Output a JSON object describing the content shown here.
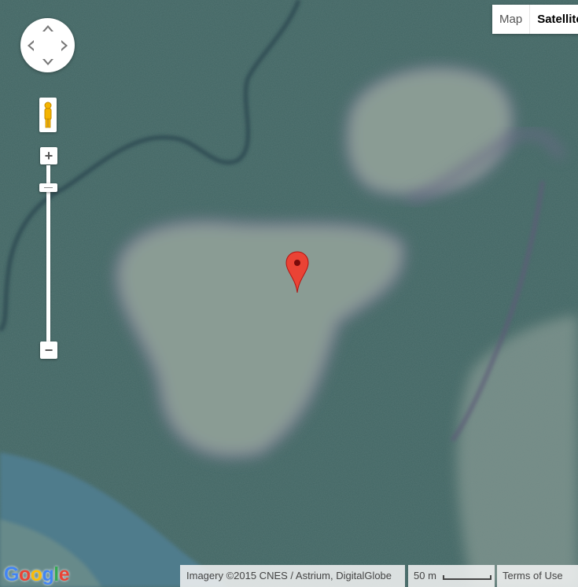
{
  "map": {
    "view": "satellite",
    "controls": {
      "zoom_in_label": "+",
      "zoom_out_label": "−",
      "pan_icon": "pan-control-icon",
      "pegman_icon": "pegman-icon"
    },
    "map_type": {
      "map_label": "Map",
      "satellite_label": "Satellite",
      "selected": "Satellite"
    },
    "marker": {
      "icon": "map-pin-icon",
      "color": "#e53935"
    },
    "footer": {
      "attribution": "Imagery ©2015 CNES / Astrium, DigitalGlobe",
      "scale_label": "50 m",
      "terms_label": "Terms of Use"
    },
    "logo": {
      "letters": [
        "G",
        "o",
        "o",
        "g",
        "l",
        "e"
      ],
      "colors": [
        "#4285f4",
        "#ea4335",
        "#fbbc05",
        "#4285f4",
        "#34a853",
        "#ea4335"
      ]
    },
    "colors": {
      "forest": "#3f6462",
      "clearing": "#8a9c94",
      "river": "#4f7c8c",
      "creek": "#2f4c52"
    }
  }
}
